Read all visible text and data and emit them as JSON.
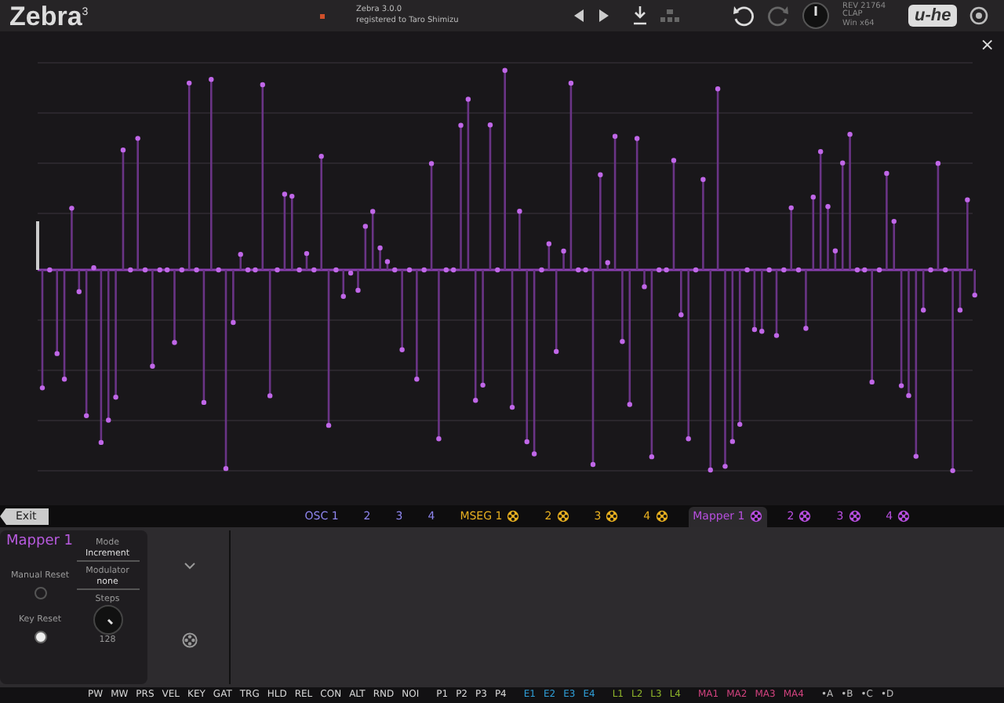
{
  "header": {
    "logo": "Zebra",
    "logo_sup": "3",
    "version": "Zebra 3.0.0",
    "registered": "registered to Taro Shimizu",
    "info": [
      "REV 21764",
      "CLAP",
      "Win x64"
    ],
    "brand": "u-he"
  },
  "graph": {
    "close": "×"
  },
  "exit": "Exit",
  "tabs": [
    {
      "label": "OSC 1",
      "kind": "osc",
      "selected": false
    },
    {
      "label": "2",
      "kind": "osc",
      "selected": false
    },
    {
      "label": "3",
      "kind": "osc",
      "selected": false
    },
    {
      "label": "4",
      "kind": "osc",
      "selected": false
    },
    {
      "label": "MSEG 1",
      "kind": "mseg",
      "selected": false
    },
    {
      "label": "2",
      "kind": "mseg",
      "selected": false
    },
    {
      "label": "3",
      "kind": "mseg",
      "selected": false
    },
    {
      "label": "4",
      "kind": "mseg",
      "selected": false
    },
    {
      "label": "Mapper 1",
      "kind": "mapper",
      "selected": true
    },
    {
      "label": "2",
      "kind": "mapper",
      "selected": false
    },
    {
      "label": "3",
      "kind": "mapper",
      "selected": false
    },
    {
      "label": "4",
      "kind": "mapper",
      "selected": false
    }
  ],
  "panel": {
    "title": "Mapper 1",
    "mode_label": "Mode",
    "mode": "Increment",
    "manual_reset_label": "Manual Reset",
    "manual_reset": false,
    "modulator_label": "Modulator",
    "modulator": "none",
    "key_reset_label": "Key Reset",
    "key_reset": true,
    "steps_label": "Steps",
    "steps": "128"
  },
  "sources": [
    {
      "label": "PW",
      "color": "#d8d8d8"
    },
    {
      "label": "MW",
      "color": "#d8d8d8"
    },
    {
      "label": "PRS",
      "color": "#d8d8d8"
    },
    {
      "label": "VEL",
      "color": "#d8d8d8"
    },
    {
      "label": "KEY",
      "color": "#d8d8d8"
    },
    {
      "label": "GAT",
      "color": "#d8d8d8"
    },
    {
      "label": "TRG",
      "color": "#d8d8d8"
    },
    {
      "label": "HLD",
      "color": "#d8d8d8"
    },
    {
      "label": "REL",
      "color": "#d8d8d8"
    },
    {
      "label": "CON",
      "color": "#d8d8d8"
    },
    {
      "label": "ALT",
      "color": "#d8d8d8"
    },
    {
      "label": "RND",
      "color": "#d8d8d8"
    },
    {
      "label": "NOI",
      "color": "#d8d8d8"
    },
    {
      "label": "P1",
      "color": "#d8d8d8"
    },
    {
      "label": "P2",
      "color": "#d8d8d8"
    },
    {
      "label": "P3",
      "color": "#d8d8d8"
    },
    {
      "label": "P4",
      "color": "#d8d8d8"
    },
    {
      "label": "E1",
      "color": "#2f9fd8"
    },
    {
      "label": "E2",
      "color": "#2f9fd8"
    },
    {
      "label": "E3",
      "color": "#2f9fd8"
    },
    {
      "label": "E4",
      "color": "#2f9fd8"
    },
    {
      "label": "L1",
      "color": "#8fb52a"
    },
    {
      "label": "L2",
      "color": "#8fb52a"
    },
    {
      "label": "L3",
      "color": "#8fb52a"
    },
    {
      "label": "L4",
      "color": "#8fb52a"
    },
    {
      "label": "MA1",
      "color": "#d2437f"
    },
    {
      "label": "MA2",
      "color": "#d2437f"
    },
    {
      "label": "MA3",
      "color": "#d2437f"
    },
    {
      "label": "MA4",
      "color": "#d2437f"
    },
    {
      "label": "•A",
      "color": "#bbbbbb"
    },
    {
      "label": "•B",
      "color": "#bbbbbb"
    },
    {
      "label": "•C",
      "color": "#bbbbbb"
    },
    {
      "label": "•D",
      "color": "#bbbbbb"
    }
  ]
}
